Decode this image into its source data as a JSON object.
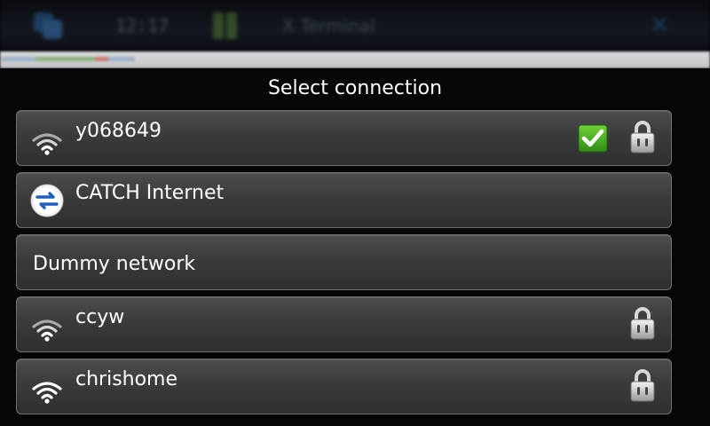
{
  "statusbar": {
    "clock": "12:17",
    "app_title": "X Terminal",
    "close_glyph": "✕"
  },
  "dialog": {
    "title": "Select connection"
  },
  "connections": [
    {
      "name": "y068649",
      "type": "wifi",
      "connected": true,
      "secured": true
    },
    {
      "name": "CATCH Internet",
      "type": "cellular",
      "connected": false,
      "secured": false
    },
    {
      "name": "Dummy network",
      "type": "dummy",
      "connected": false,
      "secured": false
    },
    {
      "name": "ccyw",
      "type": "wifi",
      "connected": false,
      "secured": true
    },
    {
      "name": "chrishome",
      "type": "wifi",
      "connected": false,
      "secured": true
    }
  ],
  "colors": {
    "accent_blue": "#1f5fbf",
    "check_green": "#3fa81f",
    "row_border": "#6f6f6f"
  },
  "icons": {
    "wifi": "wifi-signal-icon",
    "cellular": "cellular-data-icon",
    "connected": "checkmark-icon",
    "secured": "padlock-icon"
  }
}
